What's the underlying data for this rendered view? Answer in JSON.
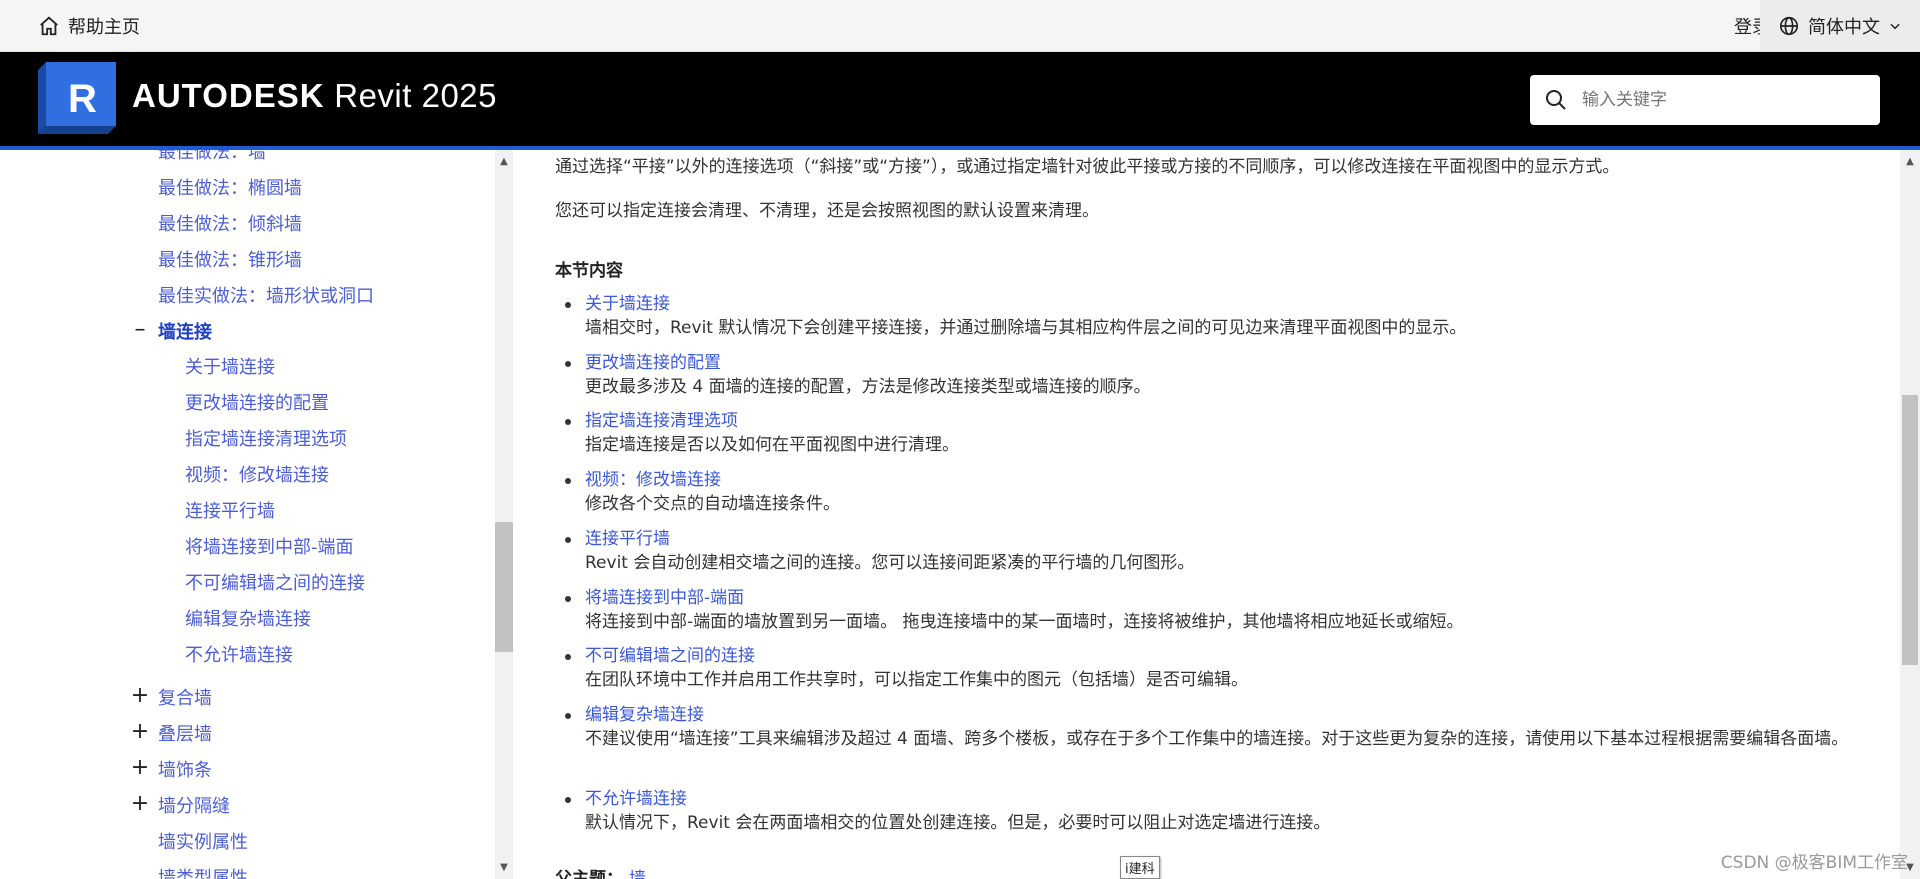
{
  "topbar": {
    "home_label": "帮助主页",
    "login_label": "登录",
    "language_label": "简体中文"
  },
  "brand": {
    "logo_letter": "R",
    "company": "AUTODESK",
    "product": "Revit 2025"
  },
  "search": {
    "placeholder": "输入关键字"
  },
  "sidebar": {
    "items": [
      {
        "label": "最佳做法：墙"
      },
      {
        "label": "最佳做法：椭圆墙"
      },
      {
        "label": "最佳做法：倾斜墙"
      },
      {
        "label": "最佳做法：锥形墙"
      },
      {
        "label": "最佳实做法：墙形状或洞口"
      },
      {
        "label": "墙连接",
        "toggle": "–"
      },
      {
        "label": "关于墙连接"
      },
      {
        "label": "更改墙连接的配置"
      },
      {
        "label": "指定墙连接清理选项"
      },
      {
        "label": "视频：修改墙连接"
      },
      {
        "label": "连接平行墙"
      },
      {
        "label": "将墙连接到中部-端面"
      },
      {
        "label": "不可编辑墙之间的连接"
      },
      {
        "label": "编辑复杂墙连接"
      },
      {
        "label": "不允许墙连接"
      },
      {
        "label": "复合墙",
        "toggle": "+"
      },
      {
        "label": "叠层墙",
        "toggle": "+"
      },
      {
        "label": "墙饰条",
        "toggle": "+"
      },
      {
        "label": "墙分隔缝",
        "toggle": "+"
      },
      {
        "label": "墙实例属性"
      },
      {
        "label": "墙类型属性"
      }
    ]
  },
  "content": {
    "intro1": "通过选择“平接”以外的连接选项（“斜接”或“方接”），或通过指定墙针对彼此平接或方接的不同顺序，可以修改连接在平面视图中的显示方式。",
    "intro2": "您还可以指定连接会清理、不清理，还是会按照视图的默认设置来清理。",
    "section_title": "本节内容",
    "list": [
      {
        "link": "关于墙连接",
        "desc": "墙相交时，Revit 默认情况下会创建平接连接，并通过删除墙与其相应构件层之间的可见边来清理平面视图中的显示。"
      },
      {
        "link": "更改墙连接的配置",
        "desc": "更改最多涉及 4 面墙的连接的配置，方法是修改连接类型或墙连接的顺序。"
      },
      {
        "link": "指定墙连接清理选项",
        "desc": "指定墙连接是否以及如何在平面视图中进行清理。"
      },
      {
        "link": "视频：修改墙连接",
        "desc": "修改各个交点的自动墙连接条件。"
      },
      {
        "link": "连接平行墙",
        "desc": "Revit 会自动创建相交墙之间的连接。您可以连接间距紧凑的平行墙的几何图形。"
      },
      {
        "link": "将墙连接到中部-端面",
        "desc": "将连接到中部-端面的墙放置到另一面墙。 拖曳连接墙中的某一面墙时，连接将被维护，其他墙将相应地延长或缩短。"
      },
      {
        "link": "不可编辑墙之间的连接",
        "desc": "在团队环境中工作并启用工作共享时，可以指定工作集中的图元（包括墙）是否可编辑。"
      },
      {
        "link": "编辑复杂墙连接",
        "desc": "不建议使用“墙连接”工具来编辑涉及超过 4 面墙、跨多个楼板，或存在于多个工作集中的墙连接。对于这些更为复杂的连接，请使用以下基本过程根据需要编辑各面墙。"
      },
      {
        "link": "不允许墙连接",
        "desc": "默认情况下，Revit 会在两面墙相交的位置处创建连接。但是，必要时可以阻止对选定墙进行连接。"
      }
    ],
    "parent_label": "父主题：",
    "parent_link": "墙"
  },
  "tooltip": "i建科",
  "watermark": "CSDN @极客BIM工作室",
  "colors": {
    "accent": "#1f5bd1",
    "link": "#3b58d6",
    "header_bg": "#000000",
    "logo_blue": "#2f6fe0"
  }
}
